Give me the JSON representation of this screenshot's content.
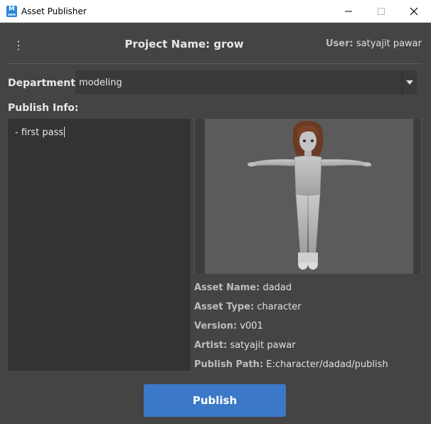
{
  "window": {
    "title": "Asset Publisher",
    "icon_letter": "M"
  },
  "header": {
    "project_name": "Project Name: grow",
    "user_label": "User:",
    "user_value": "satyajit pawar",
    "menu_icon": "⋮"
  },
  "department": {
    "label": "Department:",
    "selected": "modeling"
  },
  "publish_info": {
    "label": "Publish Info:",
    "text": "- first pass"
  },
  "asset": {
    "name_label": "Asset Name:",
    "name_value": "dadad",
    "type_label": "Asset Type:",
    "type_value": "character",
    "version_label": "Version:",
    "version_value": "v001",
    "artist_label": "Artist:",
    "artist_value": "satyajit pawar",
    "path_label": "Publish Path:",
    "path_value": "E:character/dadad/publish"
  },
  "actions": {
    "publish_label": "Publish"
  },
  "colors": {
    "background": "#444444",
    "accent": "#3b78c8",
    "field": "#333333"
  }
}
